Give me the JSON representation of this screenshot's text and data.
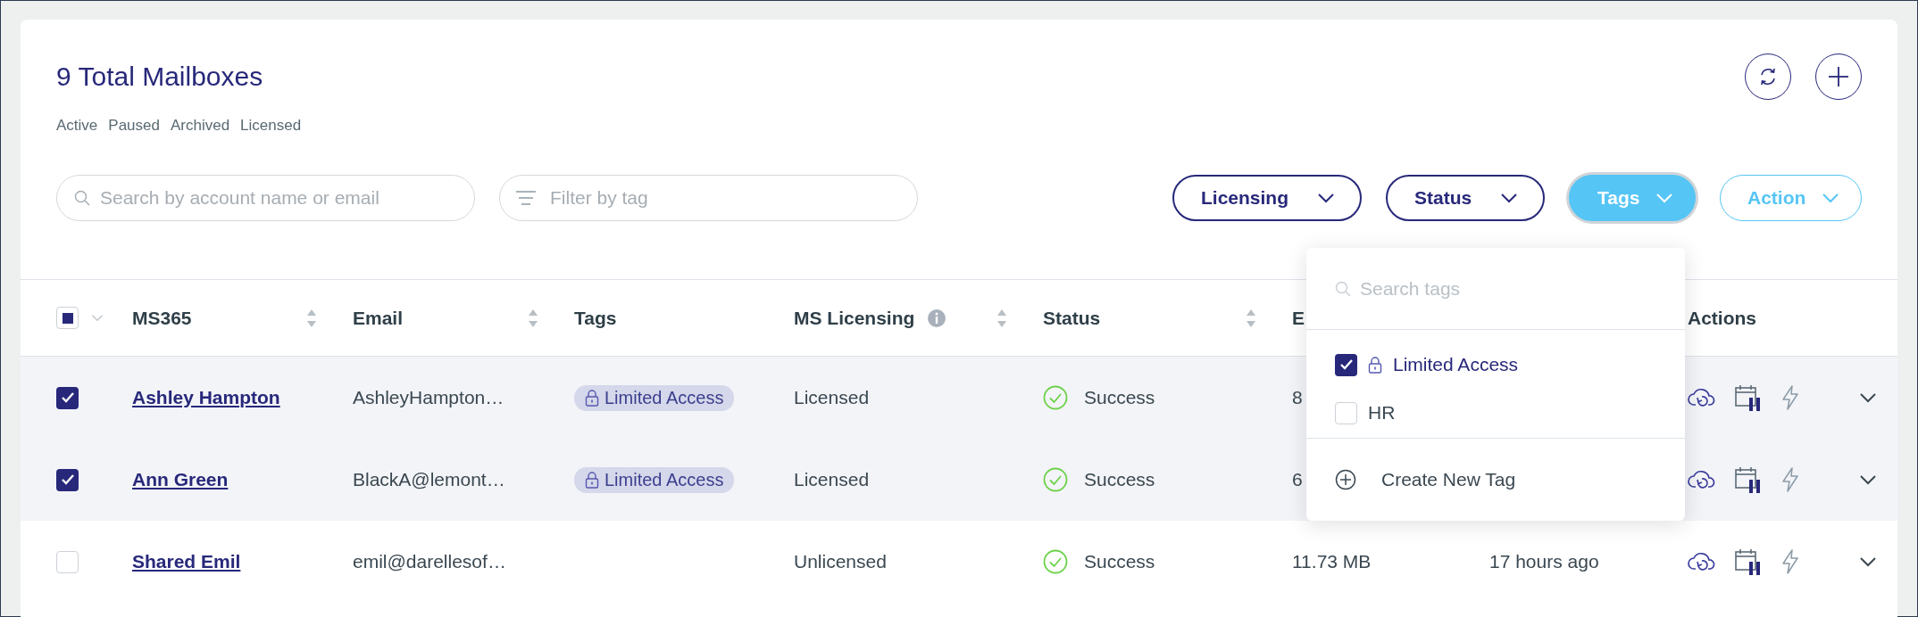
{
  "header": {
    "title": "9 Total Mailboxes",
    "filters": [
      {
        "label": "Active"
      },
      {
        "label": "Paused"
      },
      {
        "label": "Archived"
      },
      {
        "label": "Licensed"
      }
    ]
  },
  "search": {
    "placeholder": "Search by account name or email"
  },
  "tag_filter": {
    "placeholder": "Filter by tag"
  },
  "pills": [
    {
      "label": "Licensing",
      "kind": "filter",
      "selected": false
    },
    {
      "label": "Status",
      "kind": "filter",
      "selected": false
    },
    {
      "label": "Tags",
      "kind": "filter",
      "selected": true
    },
    {
      "label": "Action",
      "kind": "action",
      "selected": false
    }
  ],
  "table": {
    "select_all_partial": true,
    "columns": [
      {
        "label": "MS365",
        "sortable": true,
        "info": false
      },
      {
        "label": "Email",
        "sortable": true,
        "info": false
      },
      {
        "label": "Tags",
        "sortable": false,
        "info": false
      },
      {
        "label": "MS Licensing",
        "sortable": true,
        "info": true
      },
      {
        "label": "Status",
        "sortable": true,
        "info": false
      },
      {
        "label": "E",
        "sortable": false,
        "info": false
      },
      {
        "label": "Actions",
        "sortable": false,
        "info": false
      }
    ],
    "rows": [
      {
        "checked": true,
        "name": "Ashley Hampton",
        "email": "AshleyHampton…",
        "tags": [
          {
            "label": "Limited Access",
            "locked": true
          }
        ],
        "ms_licensing": "Licensed",
        "status": {
          "kind": "success",
          "label": "Success"
        },
        "column_6": "8"
      },
      {
        "checked": true,
        "name": "Ann Green",
        "email": "BlackA@lemont…",
        "tags": [
          {
            "label": "Limited Access",
            "locked": true
          }
        ],
        "ms_licensing": "Licensed",
        "status": {
          "kind": "success",
          "label": "Success"
        },
        "column_6": "6"
      },
      {
        "checked": false,
        "name": "Shared Emil",
        "email": "emil@darellesof…",
        "tags": [],
        "ms_licensing": "Unlicensed",
        "status": {
          "kind": "success",
          "label": "Success"
        },
        "column_6": "11.73 MB",
        "column_7": "17 hours ago"
      }
    ]
  },
  "tag_menu": {
    "placeholder": "Search tags",
    "items": [
      {
        "label": "Limited Access",
        "locked": true,
        "checked": true
      },
      {
        "label": "HR",
        "locked": false,
        "checked": false
      }
    ],
    "create_label": "Create New Tag"
  }
}
